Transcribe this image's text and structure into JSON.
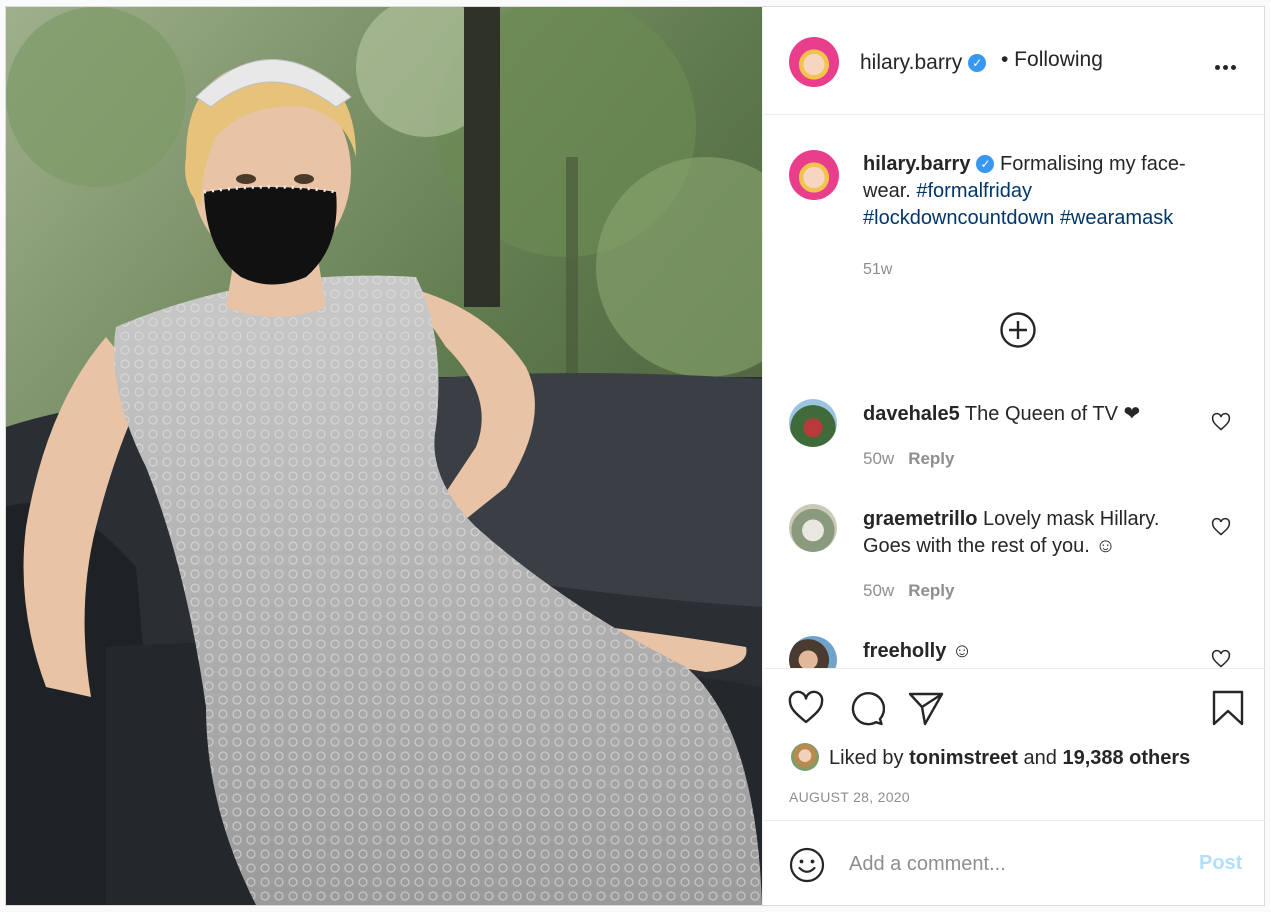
{
  "post": {
    "author": "hilary.barry",
    "follow_status": "• Following",
    "verified": true,
    "caption_text": " Formalising my face-wear. ",
    "hashtags": [
      "#formalfriday",
      "#lockdowncountdown",
      "#wearamask"
    ],
    "caption_time": "51w",
    "accent_color": "#3897f0"
  },
  "comments": [
    {
      "user": "davehale5",
      "text": " The Queen of TV ❤",
      "time": "50w",
      "reply": "Reply"
    },
    {
      "user": "graemetrillo",
      "text": " Lovely mask Hillary. Goes with the rest of you. ☺",
      "time": "50w",
      "reply": "Reply"
    },
    {
      "user": "freeholly",
      "text": " ☺",
      "time": "",
      "reply": ""
    }
  ],
  "likes": {
    "prefix": "Liked by ",
    "user": "tonimstreet",
    "middle": " and ",
    "count": "19,388 others"
  },
  "date": "AUGUST 28, 2020",
  "composer": {
    "placeholder": "Add a comment...",
    "post_label": "Post"
  },
  "icons": {
    "more": "more-options-icon",
    "add": "plus-circle-icon",
    "like": "heart-icon",
    "comment": "comment-icon",
    "share": "paper-plane-icon",
    "save": "bookmark-icon",
    "emoji": "emoji-icon"
  }
}
